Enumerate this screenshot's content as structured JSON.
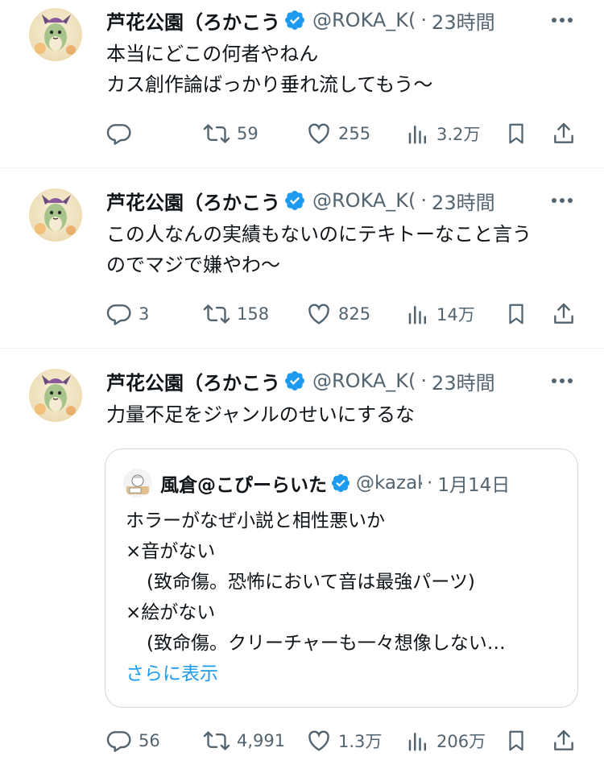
{
  "colors": {
    "text": "#0f1419",
    "secondary": "#536471",
    "accent": "#1d9bf0",
    "verified": "#1d9bf0",
    "divider": "#eff3f4"
  },
  "tweets": [
    {
      "name": "芦花公園（ろかこう",
      "handle": "@ROKA_K(",
      "time": "23時間",
      "lines": [
        "本当にどこの何者やねん",
        "カス創作論ばっかり垂れ流してもう〜"
      ],
      "reply_count": "",
      "retweet_count": "59",
      "like_count": "255",
      "view_count": "3.2万"
    },
    {
      "name": "芦花公園（ろかこう",
      "handle": "@ROKA_K(",
      "time": "23時間",
      "lines": [
        "この人なんの実績もないのにテキトーなこと言う",
        "のでマジで嫌やわ〜"
      ],
      "reply_count": "3",
      "retweet_count": "158",
      "like_count": "825",
      "view_count": "14万"
    },
    {
      "name": "芦花公園（ろかこう",
      "handle": "@ROKA_K(",
      "time": "23時間",
      "lines": [
        "力量不足をジャンルのせいにするな"
      ],
      "reply_count": "56",
      "retweet_count": "4,991",
      "like_count": "1.3万",
      "view_count": "206万",
      "quote": {
        "name": "風倉@こぴーらいた",
        "handle": "@kazaku",
        "date": "1月14日",
        "lines": [
          "ホラーがなぜ小説と相性悪いか",
          "×音がない",
          "(致命傷。恐怖において音は最強パーツ)",
          "×絵がない",
          "(致命傷。クリーチャーも一々想像しない…"
        ],
        "show_more": "さらに表示"
      }
    }
  ]
}
